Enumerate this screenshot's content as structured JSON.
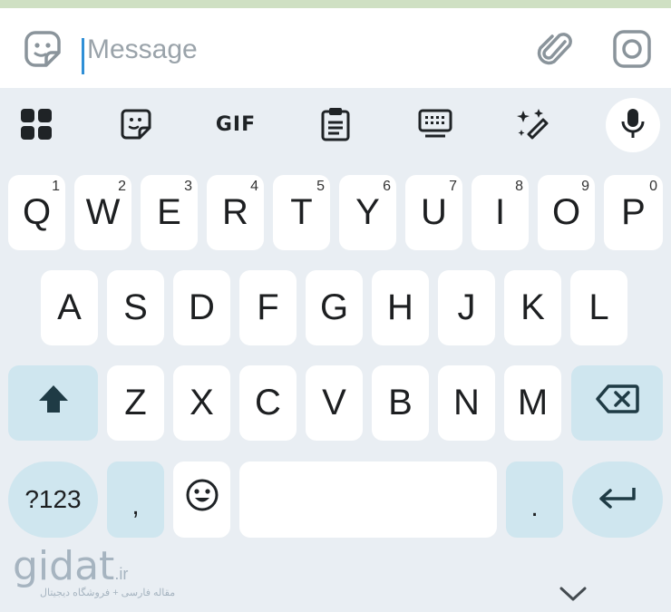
{
  "message_bar": {
    "placeholder": "Message"
  },
  "toolbar": {
    "gif_label": "GIF"
  },
  "keyboard": {
    "row1": [
      {
        "letter": "Q",
        "num": "1"
      },
      {
        "letter": "W",
        "num": "2"
      },
      {
        "letter": "E",
        "num": "3"
      },
      {
        "letter": "R",
        "num": "4"
      },
      {
        "letter": "T",
        "num": "5"
      },
      {
        "letter": "Y",
        "num": "6"
      },
      {
        "letter": "U",
        "num": "7"
      },
      {
        "letter": "I",
        "num": "8"
      },
      {
        "letter": "O",
        "num": "9"
      },
      {
        "letter": "P",
        "num": "0"
      }
    ],
    "row2": [
      "A",
      "S",
      "D",
      "F",
      "G",
      "H",
      "J",
      "K",
      "L"
    ],
    "row3": [
      "Z",
      "X",
      "C",
      "V",
      "B",
      "N",
      "M"
    ],
    "symbols_label": "?123",
    "comma_label": ",",
    "period_label": "."
  },
  "watermark": {
    "brand": "gidat",
    "tld": ".ir",
    "tagline": "مقاله فارسی + فروشگاه دیجیتال"
  },
  "colors": {
    "accent_caret": "#2f8fd6",
    "keyboard_bg": "#e9eef3",
    "function_key_bg": "#cfe6ef",
    "key_bg": "#ffffff"
  }
}
